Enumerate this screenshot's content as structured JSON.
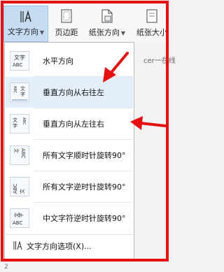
{
  "ribbon": {
    "text_direction": "文字方向",
    "margins": "页边距",
    "orientation": "纸张方向",
    "paper_size": "纸张大小"
  },
  "document_text": "cer一在线",
  "menu": {
    "items": [
      {
        "label": "水平方向",
        "icon": "horizontal-text-icon"
      },
      {
        "label": "垂直方向从右往左",
        "icon": "vertical-rtl-icon"
      },
      {
        "label": "垂直方向从左往右",
        "icon": "vertical-ltr-icon"
      },
      {
        "label": "所有文字顺时针旋转90°",
        "icon": "rotate-cw-icon"
      },
      {
        "label": "所有文字逆时针旋转90°",
        "icon": "rotate-ccw-icon"
      },
      {
        "label": "中文字符逆时针旋转90°",
        "icon": "cjk-rotate-ccw-icon"
      }
    ],
    "footer": "文字方向选项(X)..."
  },
  "icon_glyphs": {
    "wen": "文",
    "zi": "字",
    "abc": "ABC"
  },
  "bottom_number": "2",
  "colors": {
    "highlight": "#e4eefb",
    "annotation_red": "#e51010",
    "active_button": "#c6dcf3"
  }
}
